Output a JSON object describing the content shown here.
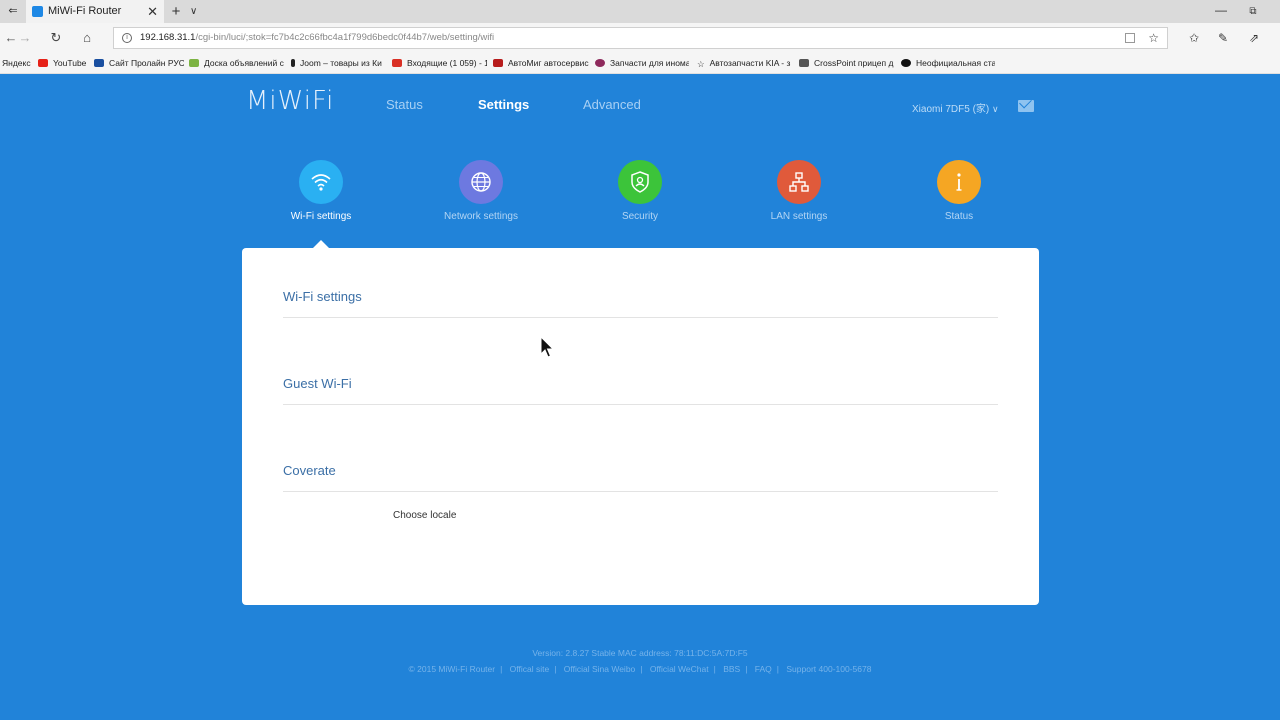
{
  "browser": {
    "tab_title": "MiWi-Fi Router",
    "tab_close": "✕",
    "new_tab": "+",
    "tab_dropdown": "∨",
    "win_min": "—",
    "win_restore": "⧉",
    "url_host": "192.168.31.1",
    "url_path": "/cgi-bin/luci/;stok=fc7b4c2c66fbc4a1f799d6bedc0f44b7/web/setting/wifi",
    "bookmarks": [
      {
        "label": "Яндекс",
        "color": "#f5f5f5"
      },
      {
        "label": "YouTube",
        "color": "#e62117"
      },
      {
        "label": "Сайт Пролайн РУС",
        "color": "#1a4fa0"
      },
      {
        "label": "Доска объявлений с",
        "color": "#7cb342"
      },
      {
        "label": "Joom – товары из Ки",
        "color": "#222222"
      },
      {
        "label": "Входящие (1 059) - 1",
        "color": "#d93025"
      },
      {
        "label": "АвтоМиг автосервис",
        "color": "#b71c1c"
      },
      {
        "label": "Запчасти для инома",
        "color": "#8e2a5c"
      },
      {
        "label": "Автозапчасти KIA - з",
        "color": "#f5f5f5"
      },
      {
        "label": "CrossPoint прицеп д",
        "color": "#555555"
      },
      {
        "label": "Неофициальная стат",
        "color": "#111111"
      }
    ]
  },
  "router": {
    "logo": "MiWiFi",
    "nav": [
      {
        "label": "Status",
        "active": false
      },
      {
        "label": "Settings",
        "active": true
      },
      {
        "label": "Advanced",
        "active": false
      }
    ],
    "device_name": "Xiaomi 7DF5 (家)",
    "categories": [
      {
        "label": "Wi-Fi settings",
        "icon": "wifi-icon",
        "color": "#2ab0f2"
      },
      {
        "label": "Network settings",
        "icon": "globe-icon",
        "color": "#6d79e0"
      },
      {
        "label": "Security",
        "icon": "shield-icon",
        "color": "#3cc43a"
      },
      {
        "label": "LAN settings",
        "icon": "network-icon",
        "color": "#e05a3b"
      },
      {
        "label": "Status",
        "icon": "info-icon",
        "color": "#f5a623"
      }
    ],
    "sections": [
      {
        "title": "Wi-Fi settings"
      },
      {
        "title": "Guest Wi-Fi"
      },
      {
        "title": "Coverate"
      }
    ],
    "locale_label": "Choose locale",
    "footer": {
      "version": "Version: 2.8.27 Stable  MAC address: 78:11:DC:5A:7D:F5",
      "copyright": "© 2015 MiWi-Fi Router",
      "links": [
        "Offical site",
        "Official Sina Weibo",
        "Official WeChat",
        "BBS",
        "FAQ",
        "Support 400-100-5678"
      ]
    }
  }
}
